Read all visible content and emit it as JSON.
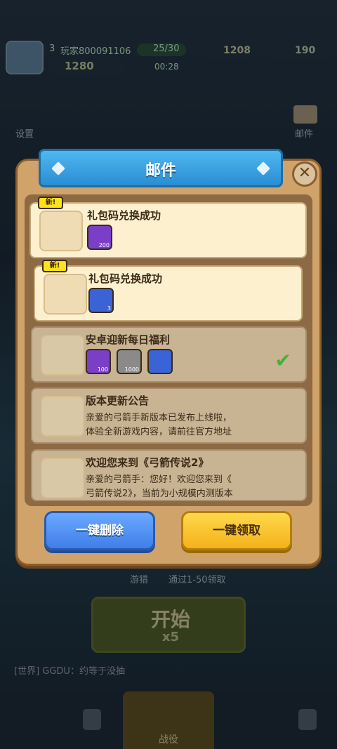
{
  "hud": {
    "level": "3",
    "player_name": "玩家800091106",
    "coins": "1280",
    "energy": "25/30",
    "timer": "00:28",
    "gold": "1208",
    "gems": "190"
  },
  "side": {
    "settings_label": "设置",
    "mail_label": "邮件"
  },
  "background": {
    "line1": "游猎",
    "line2": "通过1-50领取",
    "start_label": "开始",
    "start_cost": "x5",
    "chat_text": "[世界] GGDU：约等于没抽",
    "battle_tab": "战役"
  },
  "mail": {
    "title": "邮件",
    "new_badge": "新!",
    "items": [
      {
        "title": "礼包码兑换成功",
        "is_new": true,
        "rewards": [
          {
            "icon": "green-gem-icon",
            "count": "200"
          }
        ]
      },
      {
        "title": "礼包码兑换成功",
        "is_new": true,
        "rewards": [
          {
            "icon": "key-icon",
            "count": "3"
          }
        ]
      },
      {
        "title": "安卓迎新每日福利",
        "is_new": false,
        "claimed": true,
        "rewards": [
          {
            "icon": "green-gem-icon",
            "count": "100"
          },
          {
            "icon": "gold-coin-icon",
            "count": "1000"
          },
          {
            "icon": "key-icon",
            "count": ""
          }
        ]
      },
      {
        "title": "版本更新公告",
        "is_new": false,
        "body": "亲爱的弓箭手新版本已发布上线啦，\n体验全新游戏内容，请前往官方地址"
      },
      {
        "title": "欢迎您来到《弓箭传说2》",
        "is_new": false,
        "body": "亲爱的弓箭手：您好！欢迎您来到《\n弓箭传说2》，当前为小规模内测版本"
      }
    ],
    "delete_all_label": "一键删除",
    "claim_all_label": "一键领取"
  },
  "colors": {
    "ribbon": "#2a8dd3",
    "blue_button": "#3f7fe8",
    "yellow_button": "#f3b21a",
    "check": "#3eb43a"
  }
}
